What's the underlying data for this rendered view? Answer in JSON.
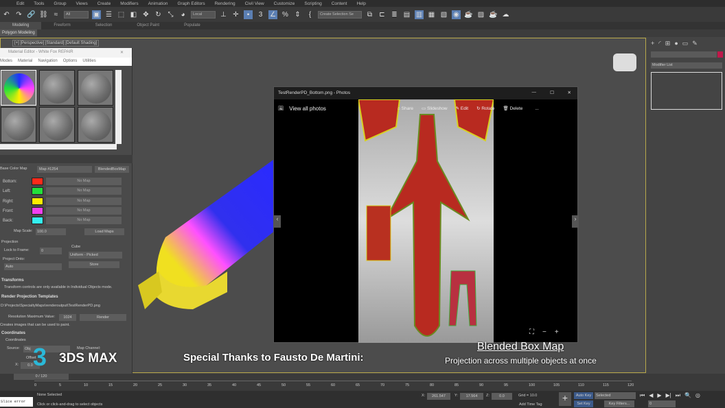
{
  "menu": [
    "Edit",
    "Tools",
    "Group",
    "Views",
    "Create",
    "Modifiers",
    "Animation",
    "Graph Editors",
    "Rendering",
    "Civil View",
    "Customize",
    "Scripting",
    "Content",
    "Help"
  ],
  "toolbar": {
    "filter": "All",
    "coord": "Local",
    "selection_set": "Create Selection Se"
  },
  "ribbon": {
    "tabs": [
      "Modeling",
      "Freeform",
      "Selection",
      "Object Paint",
      "Populate"
    ],
    "active": "Modeling",
    "panel": "Polygon Modeling"
  },
  "viewport": {
    "label": "[+] [Perspective] [Standard] [Default Shading]"
  },
  "material_editor": {
    "title": "Material Editor - White Fox REPAIR",
    "menu": [
      "Modes",
      "Material",
      "Navigation",
      "Options",
      "Utilities"
    ],
    "base_color_label": "Base Color Map",
    "map_name": "Map #1254",
    "map_type": "BlendedBoxMap",
    "faces": [
      {
        "label": "Bottom:",
        "color": "#ff2a1a",
        "map": "No Map"
      },
      {
        "label": "Left:",
        "color": "#22e03a",
        "map": "No Map"
      },
      {
        "label": "Right:",
        "color": "#ffee00",
        "map": "No Map"
      },
      {
        "label": "Front:",
        "color": "#f040f0",
        "map": "No Map"
      },
      {
        "label": "Back:",
        "color": "#33f0f0",
        "map": "No Map"
      }
    ],
    "map_scale_label": "Map Scale:",
    "map_scale": "100.0",
    "load_maps": "Load Maps",
    "projection_label": "Projection",
    "lock_to_frame_label": "Lock to Frame:",
    "lock_to_frame": "0",
    "cube_label": "Cube",
    "cube_mode": "Uniform - Picked",
    "store": "Store",
    "project_onto_label": "Project Onto:",
    "project_onto": "Auto",
    "transforms_label": "Transforms",
    "transforms_note": "Transform controls are only available in Individual Objects mode.",
    "rpt_label": "Render Projection Templates",
    "rpt_path": "D:\\Projects\\SpecialtyMaps\\renderoutput\\TestRenderPD.png",
    "res_label": "Resolution Maximum Value:",
    "res_value": "1024",
    "render": "Render",
    "rpt_note": "Creates images that can be used to paint.",
    "coords_label": "Coordinates",
    "coords_sub": "Coordinates",
    "source_label": "Source:",
    "source": "Obj",
    "map_channel_label": "Map Channel:",
    "offset_label": "Offset",
    "x_label": "X:",
    "x_value": "0.0"
  },
  "command_panel": {
    "modifier_list": "Modifier List"
  },
  "photos": {
    "title": "TestRenderPD_Bottom.png - Photos",
    "view_all": "View all photos",
    "actions": [
      "Share",
      "Slideshow",
      "Edit",
      "Rotate",
      "Delete"
    ],
    "more": "..."
  },
  "captions": {
    "thanks": "Special Thanks to Fausto De Martini:",
    "title": "Blended Box Map",
    "subtitle": "Projection across multiple objects at once",
    "logo": "3DS MAX"
  },
  "timeline": {
    "frame": "0 / 120",
    "ticks": [
      "0",
      "5",
      "10",
      "15",
      "20",
      "25",
      "30",
      "35",
      "40",
      "45",
      "50",
      "55",
      "60",
      "65",
      "70",
      "75",
      "80",
      "85",
      "90",
      "95",
      "100",
      "105",
      "110",
      "115",
      "120"
    ]
  },
  "status": {
    "selected": "None Selected",
    "prompt": "Click or click-and-drag to select objects",
    "x_label": "X:",
    "x": "261.547",
    "y_label": "Y:",
    "y": "17.564",
    "z_label": "Z:",
    "z": "0.0",
    "grid": "Grid = 10.0",
    "add_time_tag": "Add Time Tag",
    "auto_key": "Auto Key",
    "set_key": "Set Key",
    "key_mode": "Selected",
    "key_filters": "Key Filters...",
    "frame": "0",
    "script": "Slice error"
  }
}
